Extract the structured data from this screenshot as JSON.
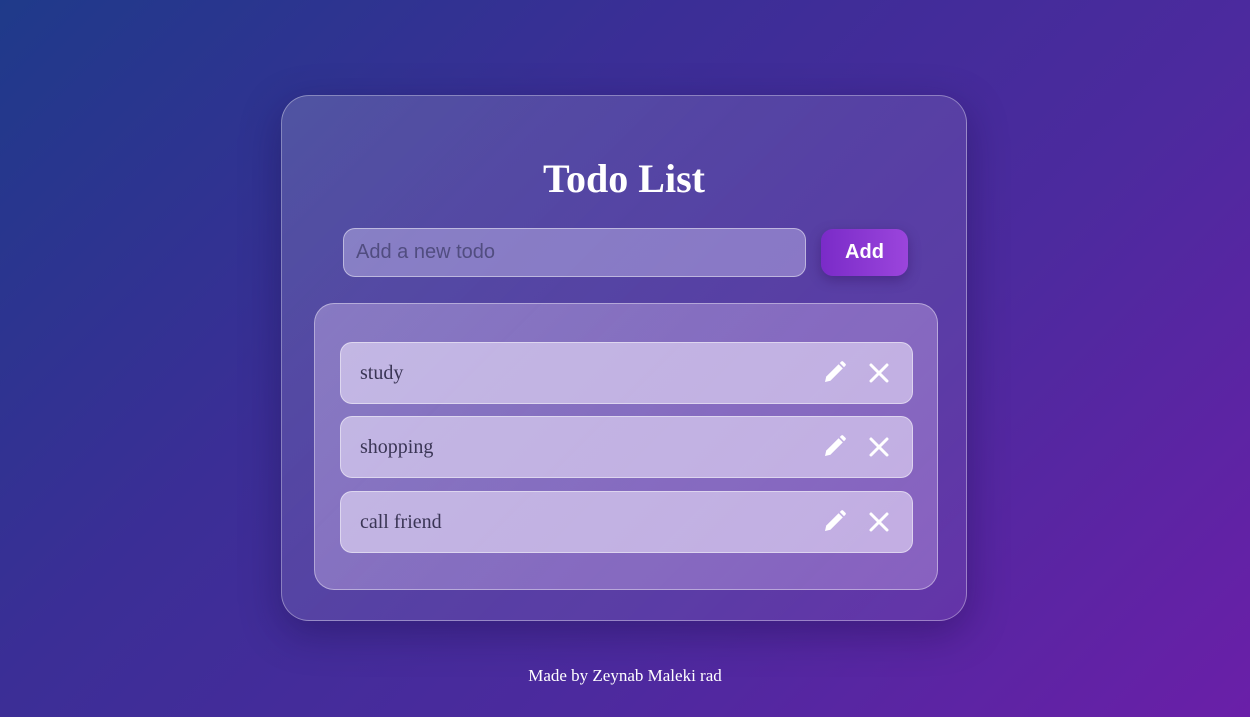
{
  "app": {
    "title": "Todo List"
  },
  "new_todo": {
    "placeholder": "Add a new todo",
    "value": "",
    "add_label": "Add"
  },
  "todos": [
    {
      "text": "study",
      "edit_icon": "pencil-icon",
      "delete_icon": "close-icon"
    },
    {
      "text": "shopping",
      "edit_icon": "pencil-icon",
      "delete_icon": "close-icon"
    },
    {
      "text": "call friend",
      "edit_icon": "pencil-icon",
      "delete_icon": "close-icon"
    }
  ],
  "footer": {
    "credit": "Made by Zeynab Maleki rad"
  },
  "colors": {
    "background_start": "#1f3a8a",
    "background_end": "#6a1fa8",
    "add_button": "#8a38d2",
    "text_dark": "#3a3555",
    "icon": "#ffffff"
  }
}
